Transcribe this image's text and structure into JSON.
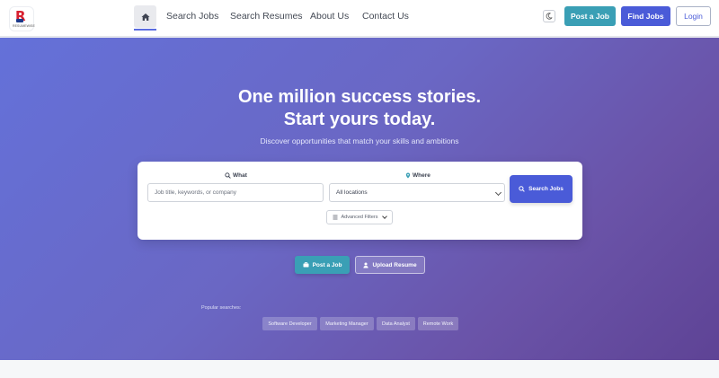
{
  "brand": {
    "logo_letter": "R",
    "logo_text": "RESUMEWISE"
  },
  "nav": {
    "home_icon": "home-icon",
    "links": [
      "Search Jobs",
      "Search Resumes",
      "About Us",
      "Contact Us"
    ]
  },
  "header_actions": {
    "theme_icon": "moon-icon",
    "post_job": "Post a Job",
    "find_jobs": "Find Jobs",
    "login": "Login"
  },
  "hero": {
    "title_line1": "One million success stories.",
    "title_line2": "Start yours today.",
    "subtitle": "Discover opportunities that match your skills and ambitions"
  },
  "search": {
    "what_label": "What",
    "what_placeholder": "Job title, keywords, or company",
    "where_label": "Where",
    "where_value": "All locations",
    "button": "Search Jobs",
    "advanced": "Advanced Filters"
  },
  "cta": {
    "post_job": "Post a Job",
    "upload_resume": "Upload Resume"
  },
  "popular": {
    "label": "Popular searches:",
    "tags": [
      "Software Developer",
      "Marketing Manager",
      "Data Analyst",
      "Remote Work"
    ]
  },
  "colors": {
    "primary": "#4a5bd8",
    "teal": "#3a9fb5",
    "hero_start": "#6471d9",
    "hero_end": "#5e4395"
  }
}
